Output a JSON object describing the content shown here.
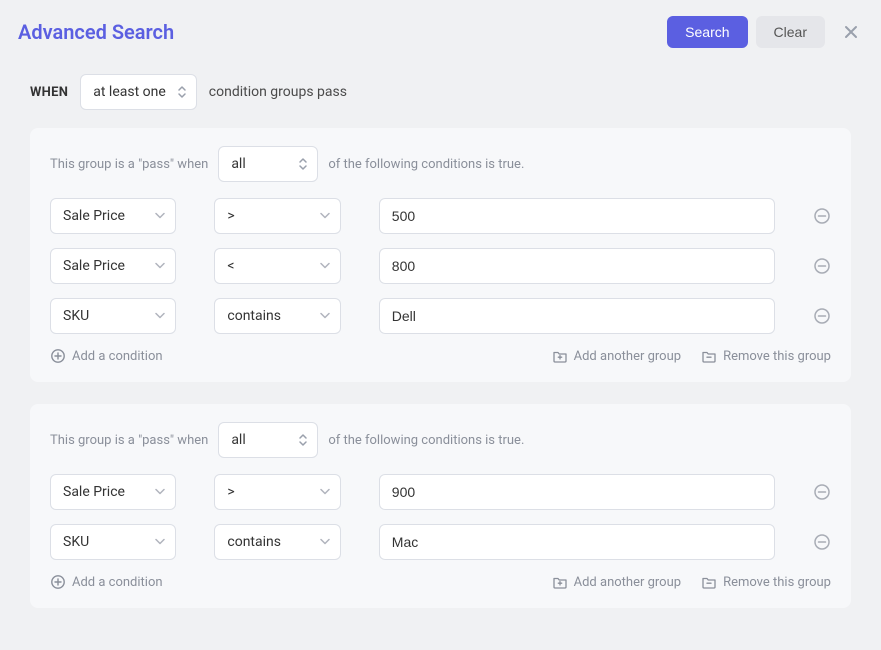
{
  "header": {
    "title": "Advanced Search",
    "search_label": "Search",
    "clear_label": "Clear"
  },
  "when": {
    "label": "WHEN",
    "select_value": "at least one",
    "suffix": "condition groups pass"
  },
  "group_texts": {
    "prefix": "This group is a \"pass\" when",
    "suffix": "of the following conditions is true.",
    "add_condition": "Add a condition",
    "add_group": "Add another group",
    "remove_group": "Remove this group"
  },
  "groups": [
    {
      "match_value": "all",
      "conditions": [
        {
          "field": "Sale Price",
          "op": ">",
          "value": "500"
        },
        {
          "field": "Sale Price",
          "op": "<",
          "value": "800"
        },
        {
          "field": "SKU",
          "op": "contains",
          "value": "Dell"
        }
      ]
    },
    {
      "match_value": "all",
      "conditions": [
        {
          "field": "Sale Price",
          "op": ">",
          "value": "900"
        },
        {
          "field": "SKU",
          "op": "contains",
          "value": "Mac"
        }
      ]
    }
  ]
}
